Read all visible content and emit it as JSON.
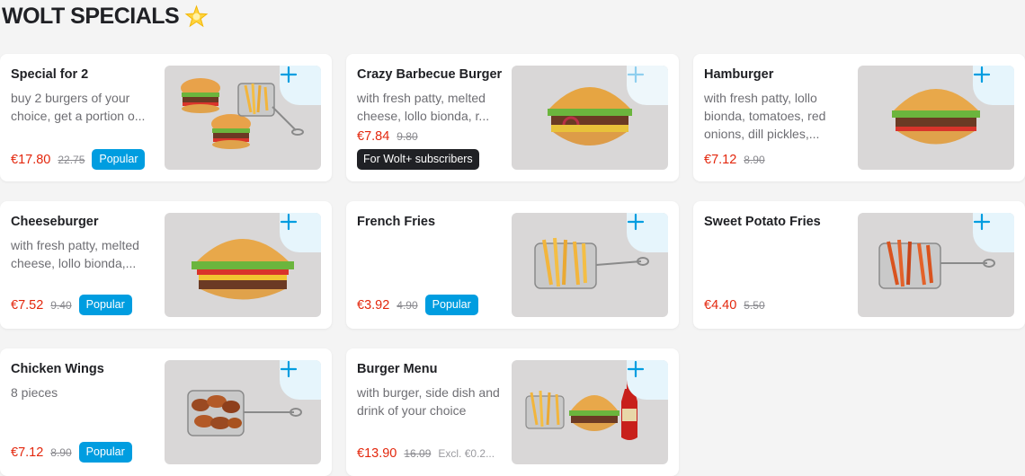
{
  "section": {
    "title": "WOLT SPECIALS",
    "icon": "star-icon"
  },
  "colors": {
    "accent": "#009de0",
    "price": "#e3270d",
    "dark_badge": "#202125",
    "image_bg": "#d9d7d7"
  },
  "items": [
    {
      "name": "Special for 2",
      "description": "buy 2 burgers of your choice, get a portion o...",
      "price": "€17.80",
      "old_price": "22.75",
      "badge": "Popular",
      "image": "two-burgers-fries-image"
    },
    {
      "name": "Crazy Barbecue Burger",
      "description": "with fresh patty, melted cheese, lollo bionda, r...",
      "price": "€7.84",
      "old_price": "9.80",
      "badge": "For Wolt+ subscribers",
      "image": "bbq-burger-image"
    },
    {
      "name": "Hamburger",
      "description": "with fresh patty, lollo bionda, tomatoes, red onions, dill pickles,...",
      "price": "€7.12",
      "old_price": "8.90",
      "badge": "",
      "image": "hamburger-image"
    },
    {
      "name": "Cheeseburger",
      "description": "with fresh patty, melted cheese, lollo bionda,...",
      "price": "€7.52",
      "old_price": "9.40",
      "badge": "Popular",
      "image": "cheeseburger-image"
    },
    {
      "name": "French Fries",
      "description": "",
      "price": "€3.92",
      "old_price": "4.90",
      "badge": "Popular",
      "image": "fries-basket-image"
    },
    {
      "name": "Sweet Potato Fries",
      "description": "",
      "price": "€4.40",
      "old_price": "5.50",
      "badge": "",
      "image": "sweet-potato-fries-image"
    },
    {
      "name": "Chicken Wings",
      "description": "8 pieces",
      "price": "€7.12",
      "old_price": "8.90",
      "badge": "Popular",
      "image": "chicken-wings-image"
    },
    {
      "name": "Burger Menu",
      "description": "with burger, side dish and drink of your choice",
      "price": "€13.90",
      "old_price": "16.09",
      "excl": "Excl. €0.2...",
      "badge": "",
      "image": "burger-menu-image"
    }
  ]
}
